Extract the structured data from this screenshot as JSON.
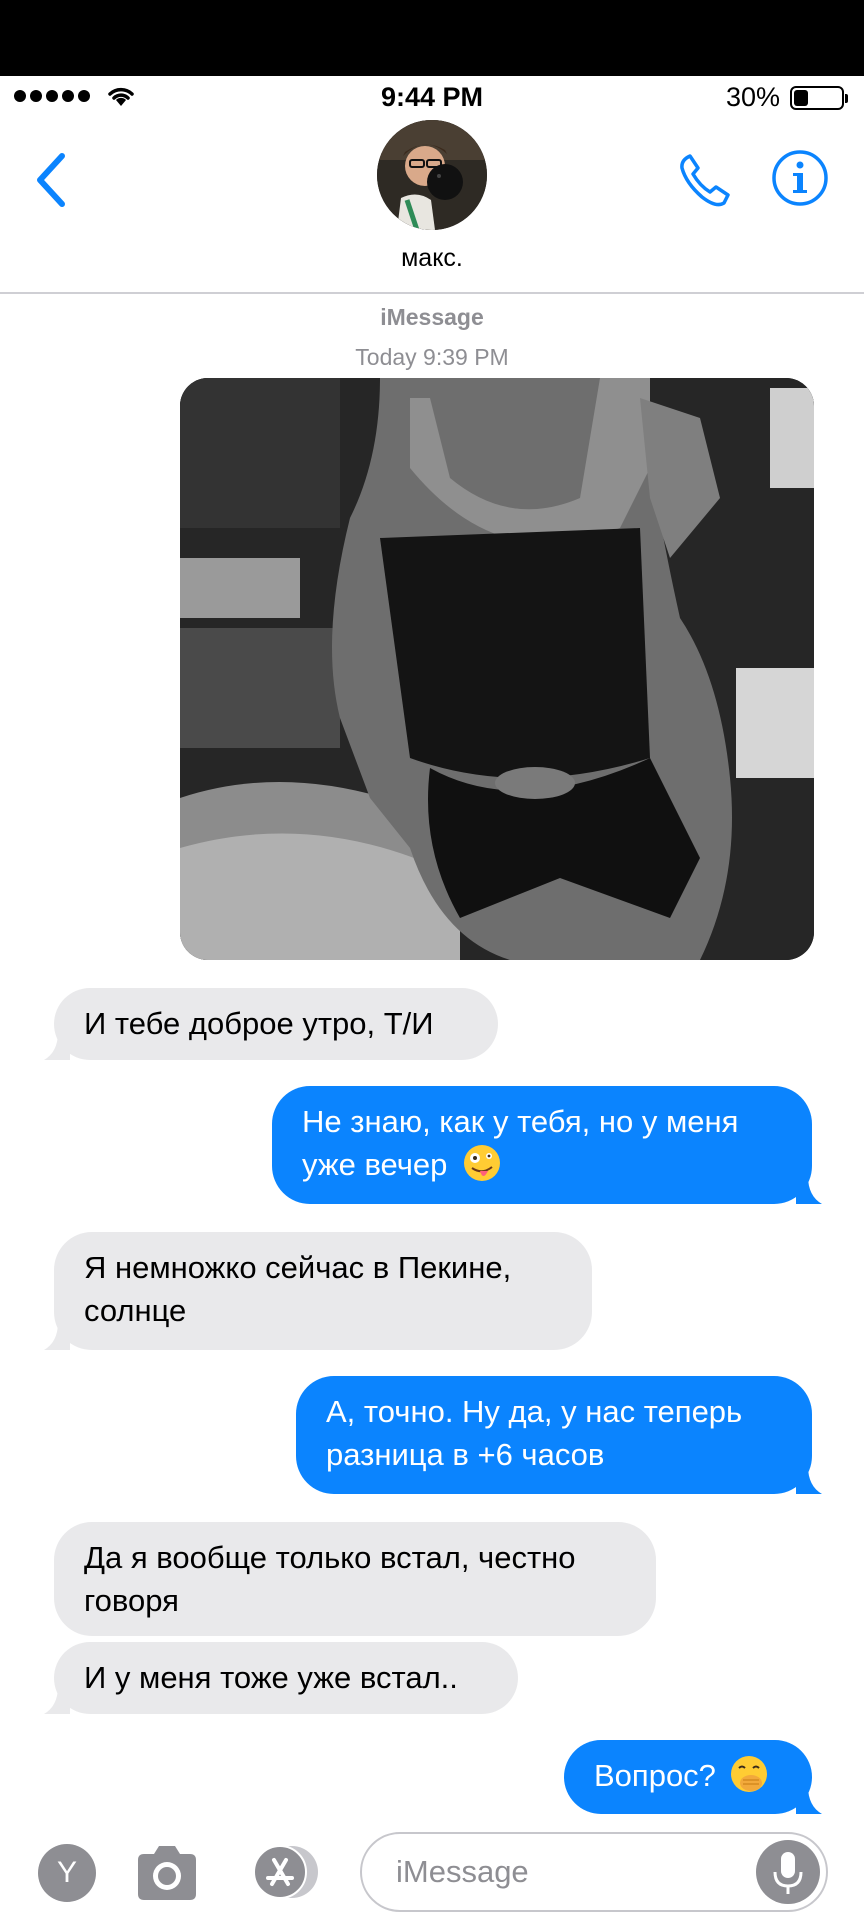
{
  "status": {
    "time": "9:44 PM",
    "battery_pct": "30%",
    "battery_level": 0.3
  },
  "header": {
    "contact_name": "макс."
  },
  "thread": {
    "service": "iMessage",
    "timestamp": "Today 9:39 PM"
  },
  "messages": [
    {
      "side": "received",
      "text": "И тебе доброе утро, Т/И"
    },
    {
      "side": "sent",
      "line1": "Не знаю, как у тебя, но у меня",
      "line2": "уже вечер",
      "emoji": "zany-face"
    },
    {
      "side": "received",
      "line1": "Я немножко сейчас в Пекине,",
      "line2": "солнце"
    },
    {
      "side": "sent",
      "line1": "А, точно. Ну да, у нас теперь",
      "line2": "разница в +6 часов"
    },
    {
      "side": "received",
      "line1": "Да я вообще только встал, честно",
      "line2": "говоря"
    },
    {
      "side": "received",
      "text": "И у меня тоже уже встал.."
    },
    {
      "side": "sent",
      "text": "Вопрос?",
      "emoji": "face-with-hand-over-mouth"
    }
  ],
  "input": {
    "y_label": "Y",
    "placeholder": "iMessage"
  },
  "colors": {
    "accent": "#0b84fe",
    "received_bubble": "#e9e9eb",
    "secondary_text": "#8e8e93"
  }
}
